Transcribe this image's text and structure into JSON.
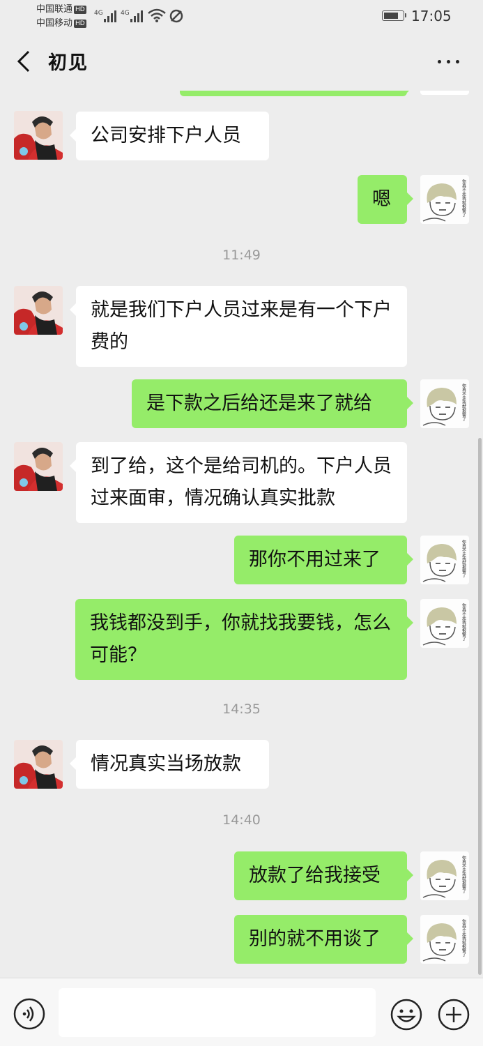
{
  "status_bar": {
    "carrier1": "中国联通",
    "carrier2": "中国移动",
    "hd_badge": "HD",
    "network1": "4G",
    "network2": "4G",
    "time": "17:05",
    "battery_level": 0.8
  },
  "header": {
    "title": "初见"
  },
  "messages": {
    "m1": "公司安排下户人员",
    "m2": "嗯",
    "t1": "11:49",
    "m3": "就是我们下户人员过来是有一个下户费的",
    "m4": "是下款之后给还是来了就给",
    "m5": "到了给，这个是给司机的。下户人员过来面审，情况确认真实批款",
    "m6": "那你不用过来了",
    "m7": "我钱都没到手，你就找我要钱，怎么可能？",
    "t2": "14:35",
    "m8": "情况真实当场放款",
    "t3": "14:40",
    "m9": "放款了给我接受",
    "m10": "别的就不用谈了"
  },
  "avatar_text": "你再不走我就报警了",
  "input_bar": {
    "placeholder": ""
  },
  "colors": {
    "outgoing_bubble": "#95ec69",
    "incoming_bubble": "#ffffff",
    "background": "#ededed"
  }
}
